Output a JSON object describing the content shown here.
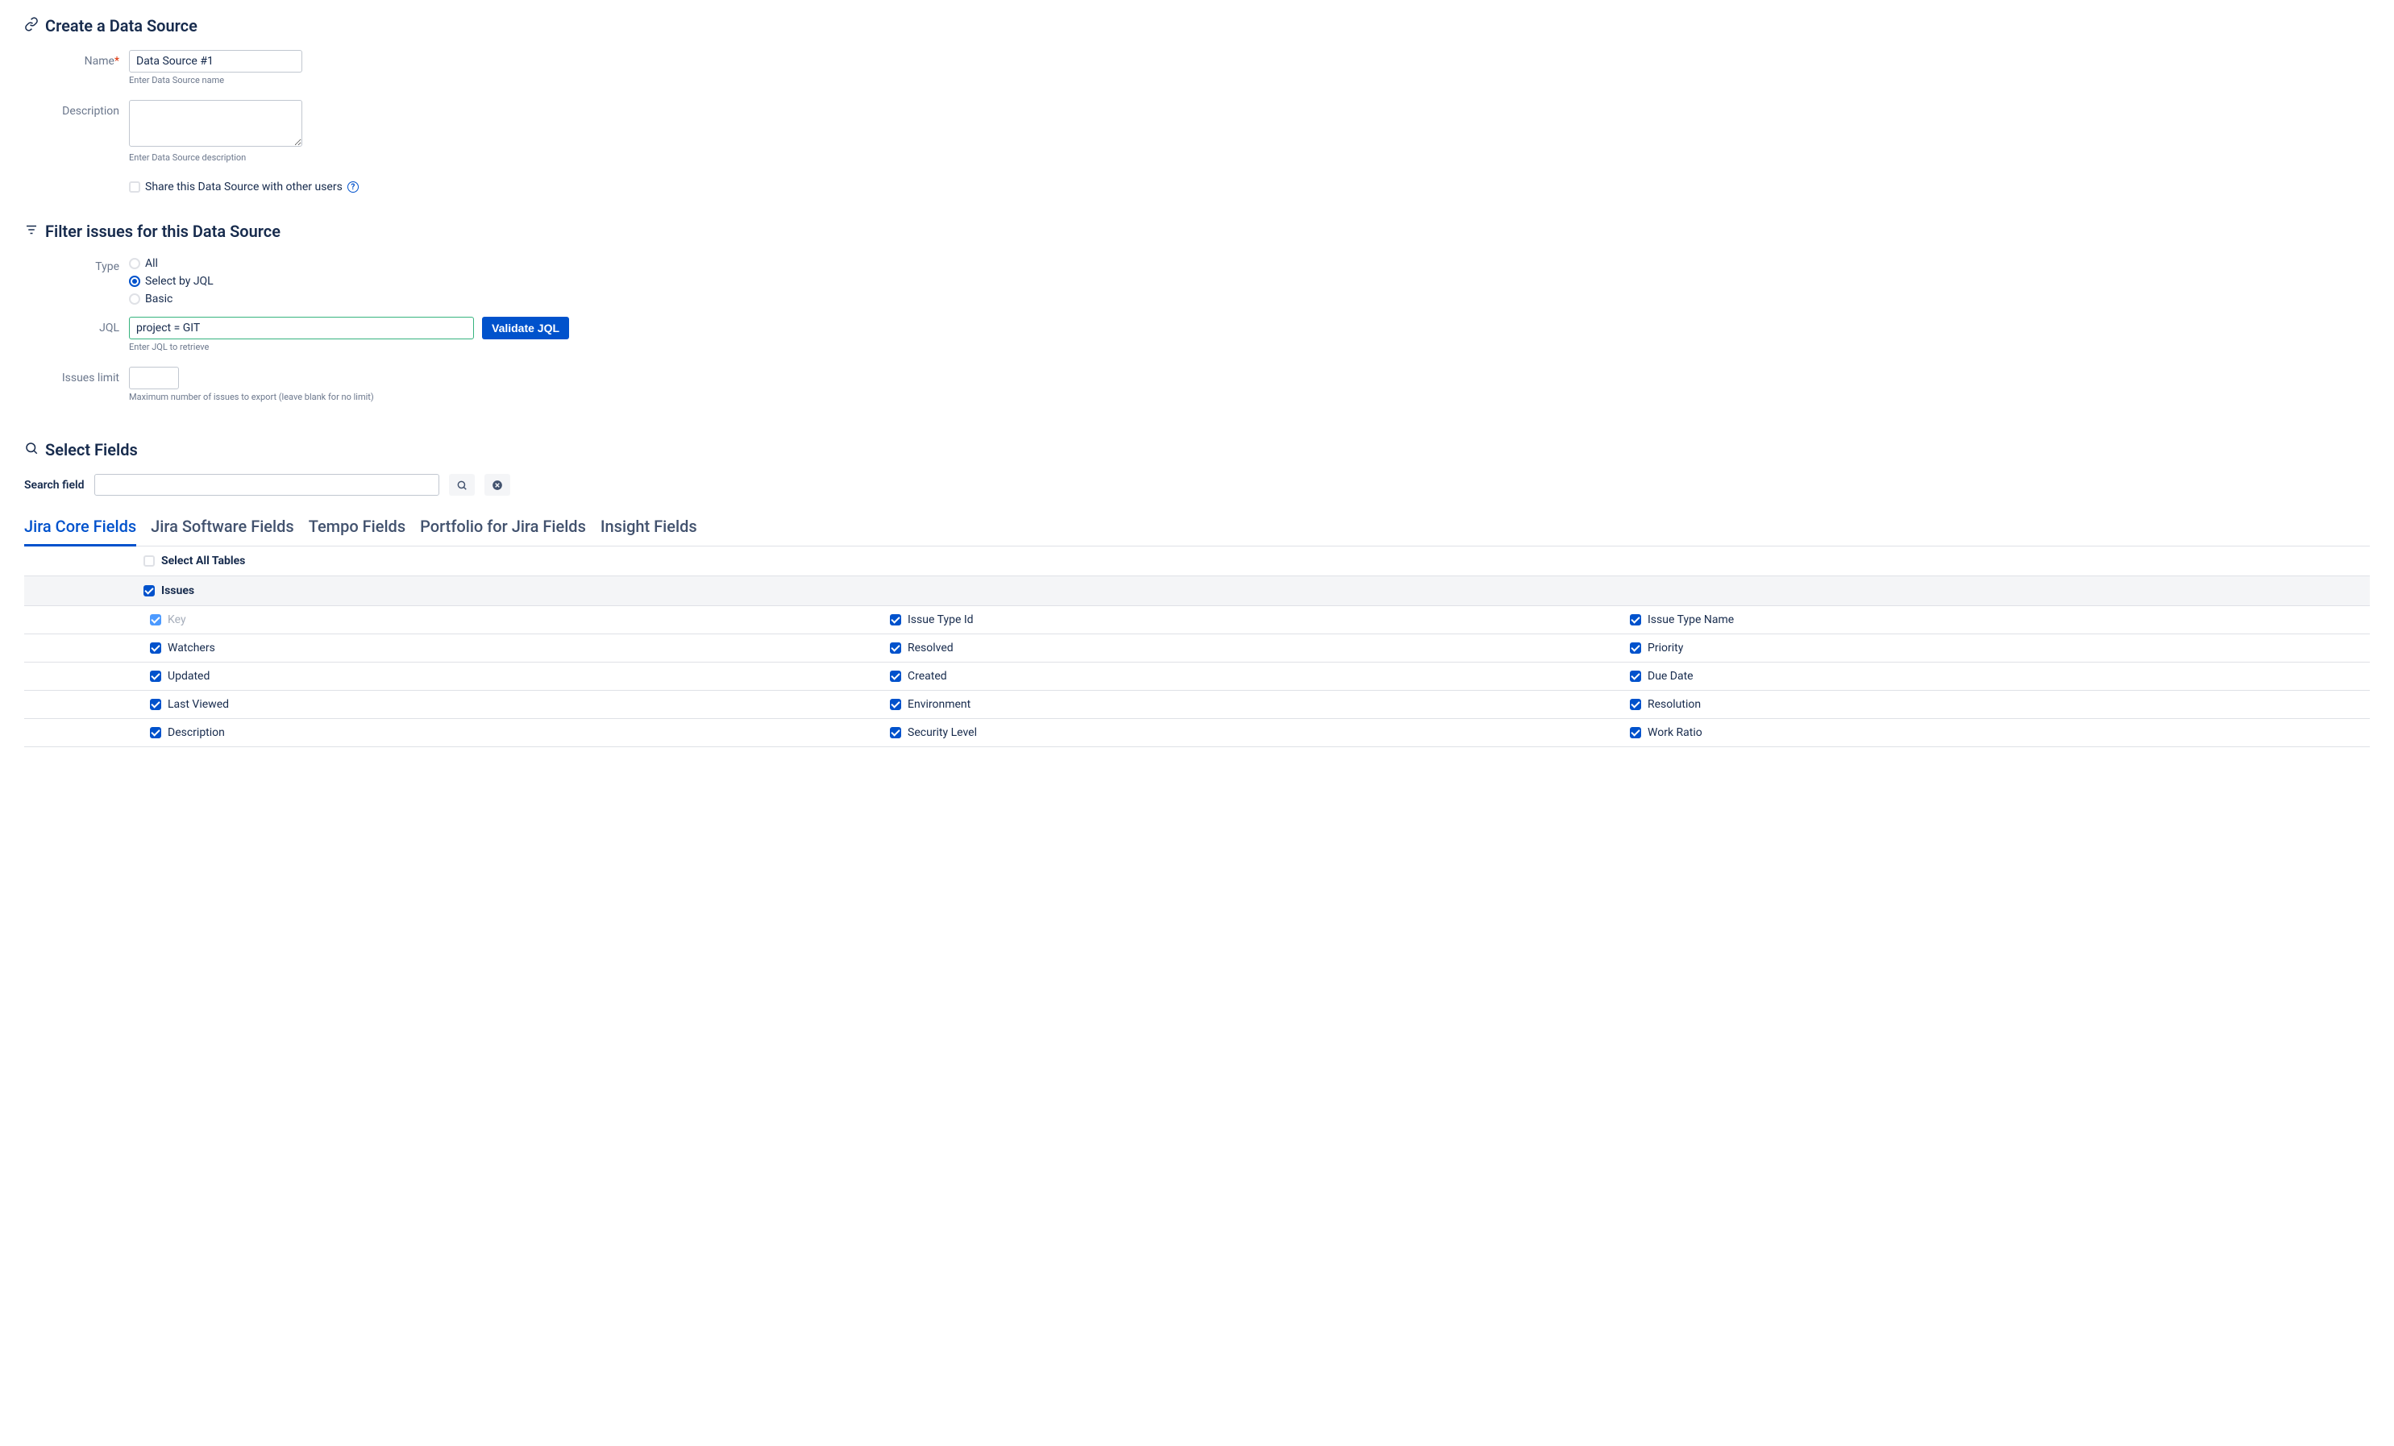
{
  "section1": {
    "title": "Create a Data Source",
    "name_label": "Name",
    "name_value": "Data Source #1",
    "name_helper": "Enter Data Source name",
    "desc_label": "Description",
    "desc_value": "",
    "desc_helper": "Enter Data Source description",
    "share_label": "Share this Data Source with other users"
  },
  "section2": {
    "title": "Filter issues for this Data Source",
    "type_label": "Type",
    "type_options": {
      "all": "All",
      "jql": "Select by JQL",
      "basic": "Basic"
    },
    "jql_label": "JQL",
    "jql_value": "project = GIT",
    "jql_helper": "Enter JQL to retrieve",
    "validate_btn": "Validate JQL",
    "limit_label": "Issues limit",
    "limit_value": "",
    "limit_helper": "Maximum number of issues to export (leave blank for no limit)"
  },
  "section3": {
    "title": "Select Fields",
    "search_label": "Search field",
    "search_value": ""
  },
  "tabs": [
    "Jira Core Fields",
    "Jira Software Fields",
    "Tempo Fields",
    "Portfolio for Jira Fields",
    "Insight Fields"
  ],
  "select_all": "Select All Tables",
  "group": "Issues",
  "fields": [
    [
      {
        "l": "Key",
        "c": true,
        "d": true
      },
      {
        "l": "Issue Type Id",
        "c": true
      },
      {
        "l": "Issue Type Name",
        "c": true
      }
    ],
    [
      {
        "l": "Watchers",
        "c": true
      },
      {
        "l": "Resolved",
        "c": true
      },
      {
        "l": "Priority",
        "c": true
      }
    ],
    [
      {
        "l": "Updated",
        "c": true
      },
      {
        "l": "Created",
        "c": true
      },
      {
        "l": "Due Date",
        "c": true
      }
    ],
    [
      {
        "l": "Last Viewed",
        "c": true
      },
      {
        "l": "Environment",
        "c": true
      },
      {
        "l": "Resolution",
        "c": true
      }
    ],
    [
      {
        "l": "Description",
        "c": true
      },
      {
        "l": "Security Level",
        "c": true
      },
      {
        "l": "Work Ratio",
        "c": true
      }
    ]
  ]
}
